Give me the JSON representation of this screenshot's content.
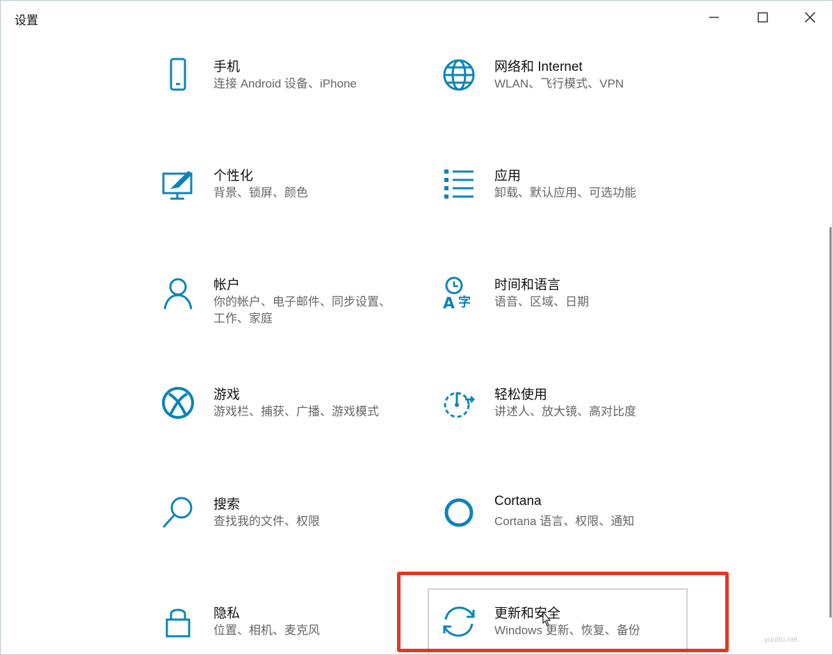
{
  "window": {
    "title": "设置",
    "controls": {
      "minimize_icon": "minimize-icon",
      "maximize_icon": "maximize-icon",
      "close_icon": "close-icon"
    }
  },
  "accent_color": "#0a84b8",
  "highlight_color": "#e8361e",
  "tiles": [
    {
      "key": "phone",
      "name": "手机",
      "desc": "连接 Android 设备、iPhone",
      "icon": "phone-icon"
    },
    {
      "key": "network",
      "name": "网络和 Internet",
      "desc": "WLAN、飞行模式、VPN",
      "icon": "globe-icon"
    },
    {
      "key": "personalization",
      "name": "个性化",
      "desc": "背景、锁屏、颜色",
      "icon": "personalization-icon"
    },
    {
      "key": "apps",
      "name": "应用",
      "desc": "卸载、默认应用、可选功能",
      "icon": "apps-list-icon"
    },
    {
      "key": "accounts",
      "name": "帐户",
      "desc": "你的帐户、电子邮件、同步设置、工作、家庭",
      "icon": "person-icon"
    },
    {
      "key": "time-language",
      "name": "时间和语言",
      "desc": "语音、区域、日期",
      "icon": "time-language-icon"
    },
    {
      "key": "gaming",
      "name": "游戏",
      "desc": "游戏栏、捕获、广播、游戏模式",
      "icon": "xbox-icon"
    },
    {
      "key": "ease-of-access",
      "name": "轻松使用",
      "desc": "讲述人、放大镜、高对比度",
      "icon": "ease-of-access-icon"
    },
    {
      "key": "search",
      "name": "搜索",
      "desc": "查找我的文件、权限",
      "icon": "search-icon"
    },
    {
      "key": "cortana",
      "name": "Cortana",
      "desc": "Cortana 语言、权限、通知",
      "icon": "cortana-icon"
    },
    {
      "key": "privacy",
      "name": "隐私",
      "desc": "位置、相机、麦克风",
      "icon": "lock-icon"
    },
    {
      "key": "update-security",
      "name": "更新和安全",
      "desc": "Windows 更新、恢复、备份",
      "icon": "update-sync-icon"
    }
  ],
  "watermark": "yunhu.net"
}
